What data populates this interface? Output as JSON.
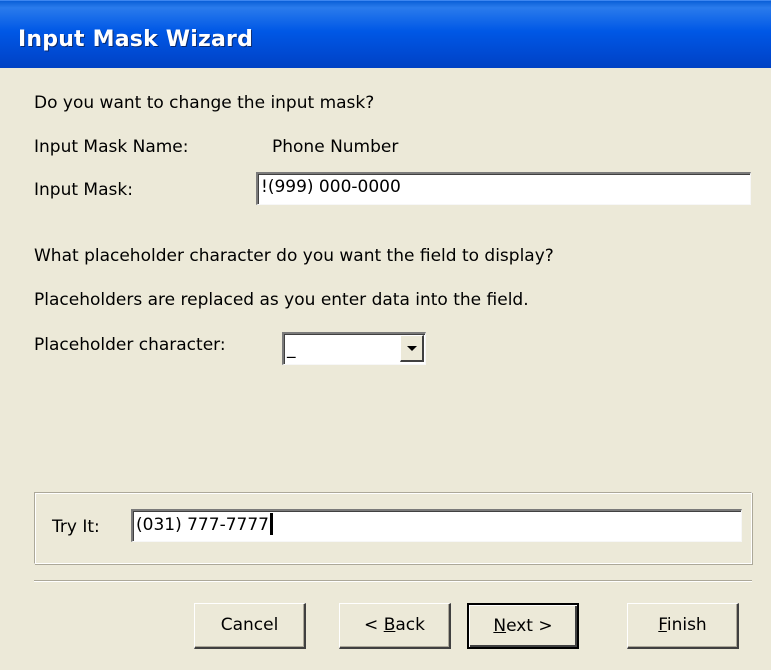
{
  "window": {
    "title": "Input Mask Wizard"
  },
  "prompt": "Do you want to change the input mask?",
  "mask_name": {
    "label": "Input Mask Name:",
    "value": "Phone Number"
  },
  "mask": {
    "label": "Input Mask:",
    "value": "!(999) 000-0000"
  },
  "placeholder_question": "What placeholder character do you want the field to display?",
  "placeholder_note": "Placeholders are replaced as you enter data into the field.",
  "placeholder": {
    "label": "Placeholder character:",
    "value": "_"
  },
  "try_it": {
    "label": "Try It:",
    "value": "(031) 777-7777"
  },
  "buttons": {
    "cancel": "Cancel",
    "back_prefix": "< ",
    "back_key": "B",
    "back_rest": "ack",
    "next_key": "N",
    "next_rest": "ext >",
    "finish_key": "F",
    "finish_rest": "inish"
  }
}
